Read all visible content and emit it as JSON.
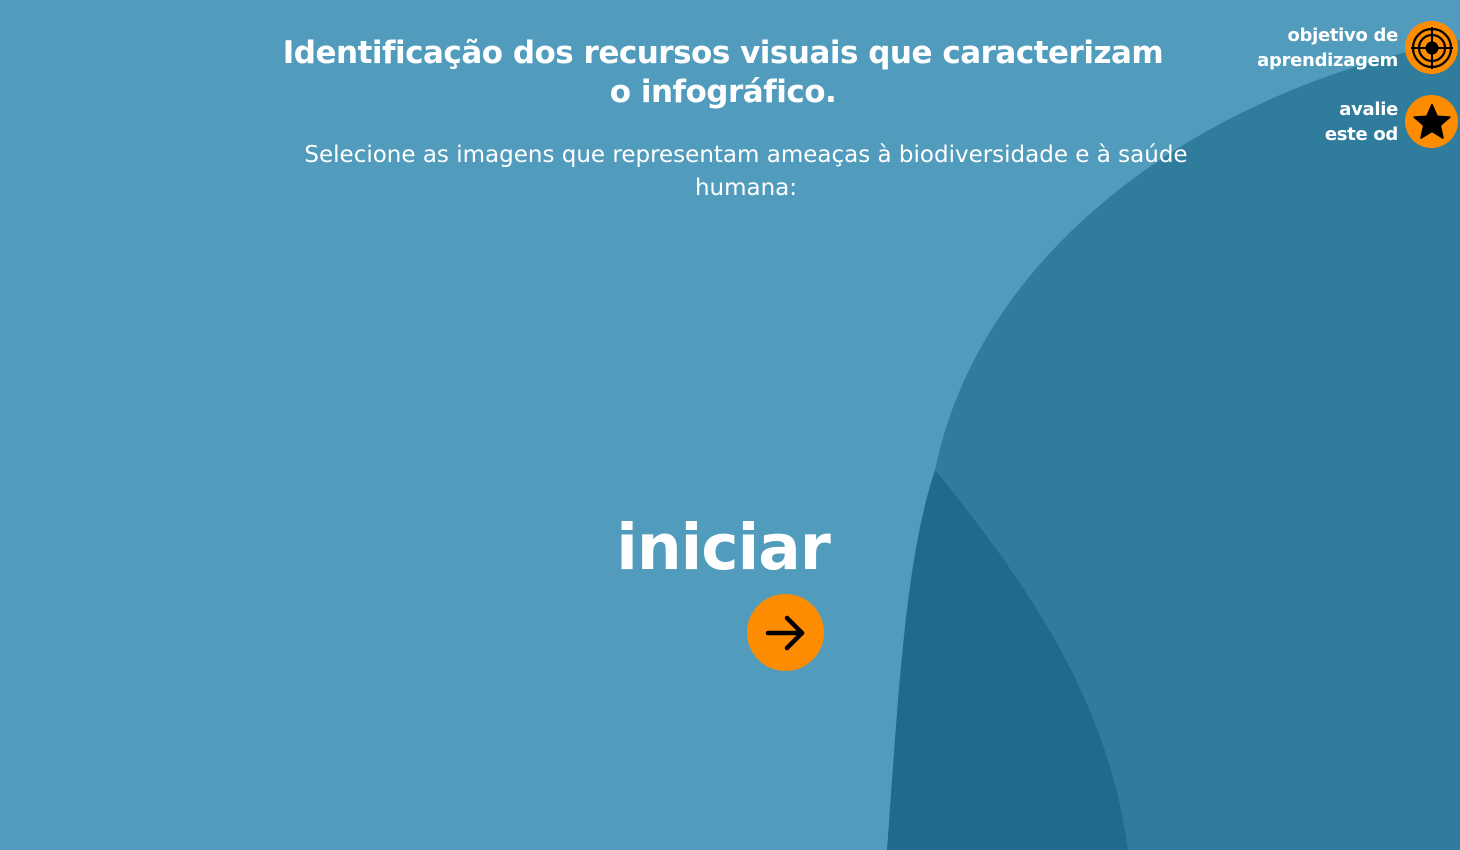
{
  "header": {
    "title": "Identificação dos recursos visuais que caracterizam o infográfico.",
    "instruction": "Selecione as imagens que representam ameaças à biodiversidade e à saúde humana:"
  },
  "side_menu": {
    "objective": {
      "line1": "objetivo de",
      "line2": "aprendizagem",
      "icon": "target-icon"
    },
    "rate": {
      "line1": "avalie",
      "line2": "este od",
      "icon": "star-icon"
    }
  },
  "start": {
    "label": "iniciar",
    "icon": "arrow-right-icon"
  },
  "colors": {
    "background": "#519cbd",
    "wave_mid": "#307c9d",
    "wave_dark": "#206b8c",
    "accent": "#fe8c00",
    "text": "#ffffff"
  }
}
